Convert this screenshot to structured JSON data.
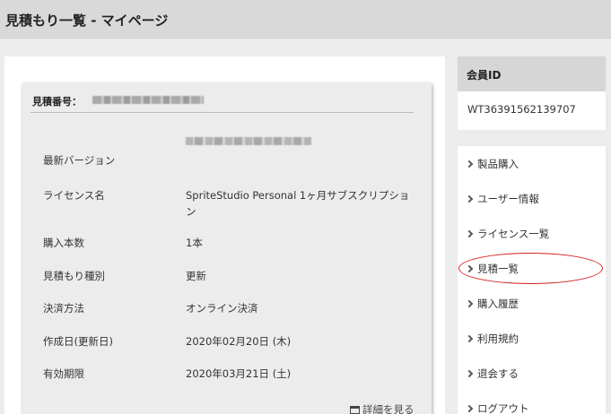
{
  "header": {
    "title": "見積もり一覧 - マイページ"
  },
  "quote": {
    "number_label": "見積番号：",
    "rows": [
      {
        "label": "最新バージョン",
        "value": ""
      },
      {
        "label": "ライセンス名",
        "value": "SpriteStudio Personal 1ヶ月サブスクリプション"
      },
      {
        "label": "購入本数",
        "value": "1本"
      },
      {
        "label": "見積もり種別",
        "value": "更新"
      },
      {
        "label": "決済方法",
        "value": "オンライン決済"
      },
      {
        "label": "作成日(更新日)",
        "value": "2020年02月20日 (木)"
      },
      {
        "label": "有効期限",
        "value": "2020年03月21日 (土)"
      }
    ],
    "detail_link": "詳細を見る",
    "detail_icon": "window-icon"
  },
  "member": {
    "heading": "会員ID",
    "id": "WT36391562139707"
  },
  "menu": {
    "items": [
      {
        "label": "製品購入"
      },
      {
        "label": "ユーザー情報"
      },
      {
        "label": "ライセンス一覧"
      },
      {
        "label": "見積一覧"
      },
      {
        "label": "購入履歴"
      },
      {
        "label": "利用規約"
      },
      {
        "label": "退会する"
      },
      {
        "label": "ログアウト"
      }
    ],
    "highlighted_item": "見積一覧",
    "highlight_color": "#d21f1f"
  }
}
